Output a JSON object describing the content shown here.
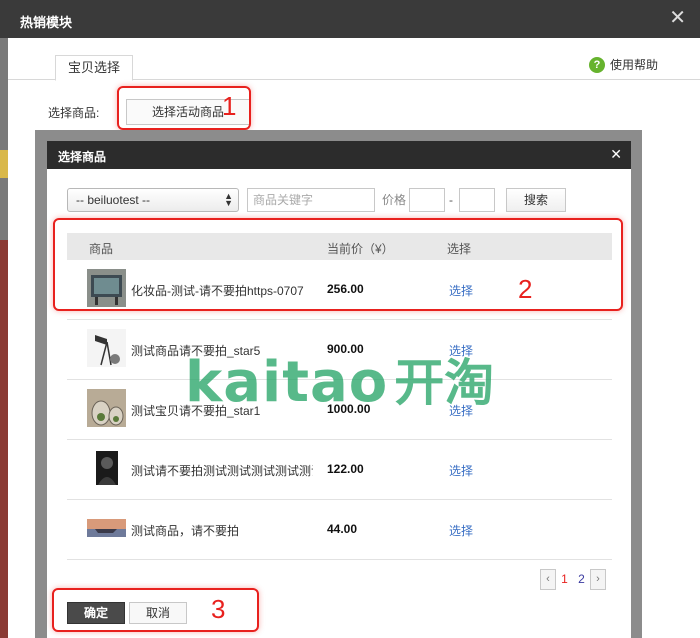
{
  "outer_dialog": {
    "title": "热销模块",
    "close_glyph": "✕",
    "tab": "宝贝选择",
    "help_text": "使用帮助",
    "help_icon_glyph": "?",
    "select_label": "选择商品:",
    "select_activity_button": "选择活动商品"
  },
  "inner_dialog": {
    "title": "选择商品",
    "close_glyph": "✕",
    "shop_select": "-- beiluotest --",
    "keyword_placeholder": "商品关键字",
    "price_label": "价格",
    "price_dash": "-",
    "search_button": "搜索",
    "columns": {
      "product": "商品",
      "price": "当前价（¥）",
      "select": "选择"
    },
    "rows": [
      {
        "name": "化妆品-测试-请不要拍https-0707",
        "price": "256.00",
        "action": "选择",
        "thumb": "tv-photo"
      },
      {
        "name": "测试商品请不要拍_star5",
        "price": "900.00",
        "action": "选择",
        "thumb": "lamp-photo"
      },
      {
        "name": "测试宝贝请不要拍_star1",
        "price": "1000.00",
        "action": "选择",
        "thumb": "terrarium-photo"
      },
      {
        "name": "测试请不要拍测试测试测试测试测试",
        "price": "122.00",
        "action": "选择",
        "thumb": "portrait-photo"
      },
      {
        "name": "测试商品，请不要拍",
        "price": "44.00",
        "action": "选择",
        "thumb": "ship-photo"
      }
    ],
    "pager": {
      "prev": "‹",
      "pages": [
        "1",
        "2"
      ],
      "next": "›"
    },
    "ok_button": "确定",
    "cancel_button": "取消"
  },
  "annotations": {
    "callout_1": "1",
    "callout_2": "2",
    "callout_3": "3"
  },
  "watermark": {
    "latin": "kaitao",
    "chinese": "开淘"
  },
  "colors": {
    "callout": "#e8211e",
    "link": "#3a6fc4",
    "header": "#2c2c2c",
    "watermark": "#2aa66a",
    "page_active": "#e8211e",
    "page_other": "#3a3aa0"
  }
}
